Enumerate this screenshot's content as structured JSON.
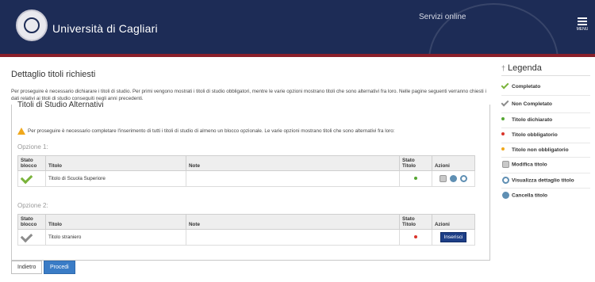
{
  "header": {
    "university_name": "Università di Cagliari",
    "servizi_online": "Servizi online",
    "menu_label": "MENU"
  },
  "page": {
    "title": "Dettaglio titoli richiesti",
    "intro": "Per proseguire è necessario dichiarare i titoli di studio. Per primi vengono mostrati i titoli di studio obbligatori, mentre le varie opzioni mostrano titoli che sono alternativi fra loro. Nelle pagine seguenti verranno chiesti i dati relativi ai titoli di studio conseguiti negli anni precedenti."
  },
  "section": {
    "legend": "Titoli di Studio Alternativi",
    "warning": "Per proseguire è necessario completare l'inserimento di tutti i titoli di studio di almeno un blocco opzionale. Le varie opzioni mostrano titoli che sono alternativi fra loro:",
    "columns": {
      "stato_blocco_1": "Stato",
      "stato_blocco_2": "blocco",
      "titolo": "Titolo",
      "note": "Note",
      "stato_titolo_1": "Stato",
      "stato_titolo_2": "Titolo",
      "azioni": "Azioni"
    },
    "options": [
      {
        "label": "Opzione 1:",
        "row": {
          "titolo": "Titolo di Scuola Superiore",
          "note": ""
        }
      },
      {
        "label": "Opzione 2:",
        "row": {
          "titolo": "Titolo straniero",
          "note": "",
          "action_button": "Inserisci"
        }
      }
    ]
  },
  "buttons": {
    "back": "Indietro",
    "next": "Procedi"
  },
  "legend": {
    "title": "Legenda",
    "items": [
      {
        "label": "Completato",
        "icon": "check-green"
      },
      {
        "label": "Non Completato",
        "icon": "check-gray"
      },
      {
        "label": "Titolo dichiarato",
        "icon": "dot-green"
      },
      {
        "label": "Titolo obbligatorio",
        "icon": "dot-red"
      },
      {
        "label": "Titolo non obbligatorio",
        "icon": "dot-orange"
      },
      {
        "label": "Modifica titolo",
        "icon": "edit-icon"
      },
      {
        "label": "Visualizza dettaglio titolo",
        "icon": "magnifier-icon"
      },
      {
        "label": "Cancella titolo",
        "icon": "delete-icon"
      }
    ]
  },
  "colors": {
    "header_bg": "#1d2c56",
    "accent_red": "#8a1f2a",
    "button_blue": "#3a7cc6",
    "green": "#7ab33b",
    "red_dot": "#d9342b",
    "orange_dot": "#f0a81c"
  }
}
